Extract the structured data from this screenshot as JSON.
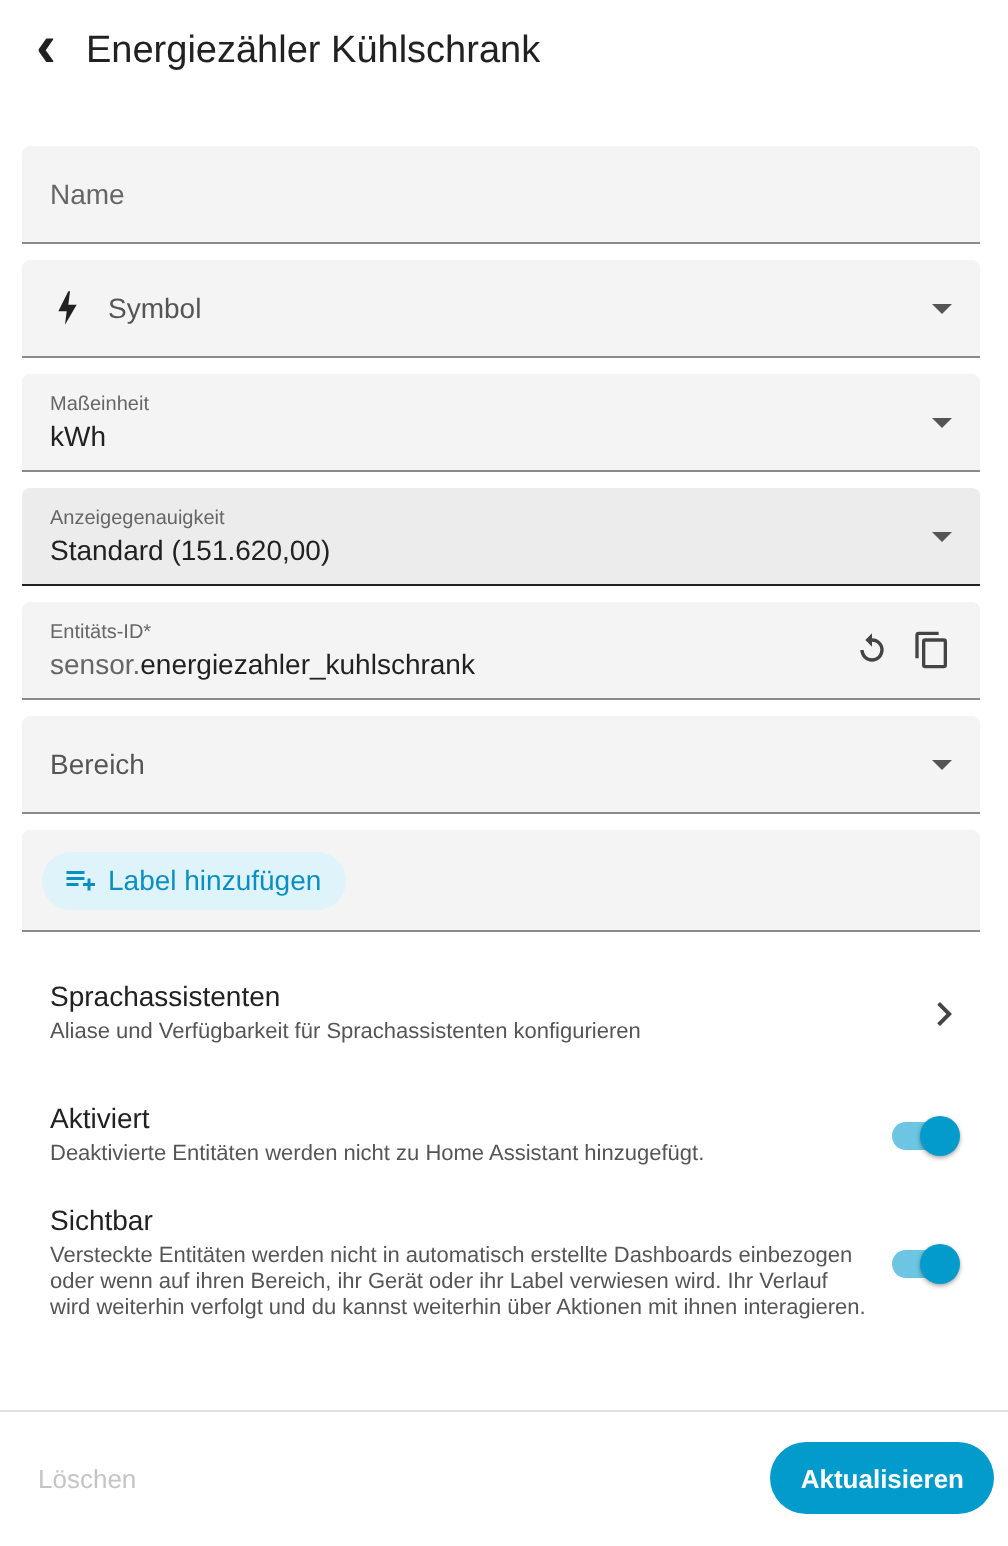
{
  "header": {
    "back": "‹",
    "title": "Energiezähler Kühlschrank"
  },
  "fields": [
    {
      "kind": "text",
      "placeholder": "Name",
      "highlighted": false
    },
    {
      "kind": "symbol-select",
      "placeholder": "Symbol",
      "highlighted": false
    },
    {
      "kind": "select",
      "label": "Maßeinheit",
      "value": "kWh",
      "highlighted": false
    },
    {
      "kind": "select",
      "label": "Anzeigegenauigkeit",
      "value": "Standard (151.620,00)",
      "highlighted": true
    },
    {
      "kind": "entity-id",
      "label": "Entitäts-ID*",
      "prefix": "sensor.",
      "value": "energiezahler_kuhlschrank",
      "highlighted": false
    },
    {
      "kind": "select",
      "placeholder": "Bereich",
      "highlighted": false
    },
    {
      "kind": "labels",
      "button": "Label hinzufügen",
      "highlighted": false
    }
  ],
  "voice": {
    "title": "Sprachassistenten",
    "description": "Aliase und Verfügbarkeit für Sprachassistenten konfigurieren"
  },
  "toggles": [
    {
      "title": "Aktiviert",
      "description": "Deaktivierte Entitäten werden nicht zu Home Assistant hinzugefügt.",
      "on": true
    },
    {
      "title": "Sichtbar",
      "description": "Versteckte Entitäten werden nicht in automatisch erstellte Dashboards einbezogen oder wenn auf ihren Bereich, ihr Gerät oder ihr Label verwiesen wird. Ihr Verlauf wird weiterhin verfolgt und du kannst weiterhin über Aktionen mit ihnen interagieren.",
      "on": true
    }
  ],
  "footer": {
    "delete": {
      "label": "Löschen",
      "disabled": true
    },
    "update": {
      "label": "Aktualisieren",
      "disabled": false
    }
  }
}
